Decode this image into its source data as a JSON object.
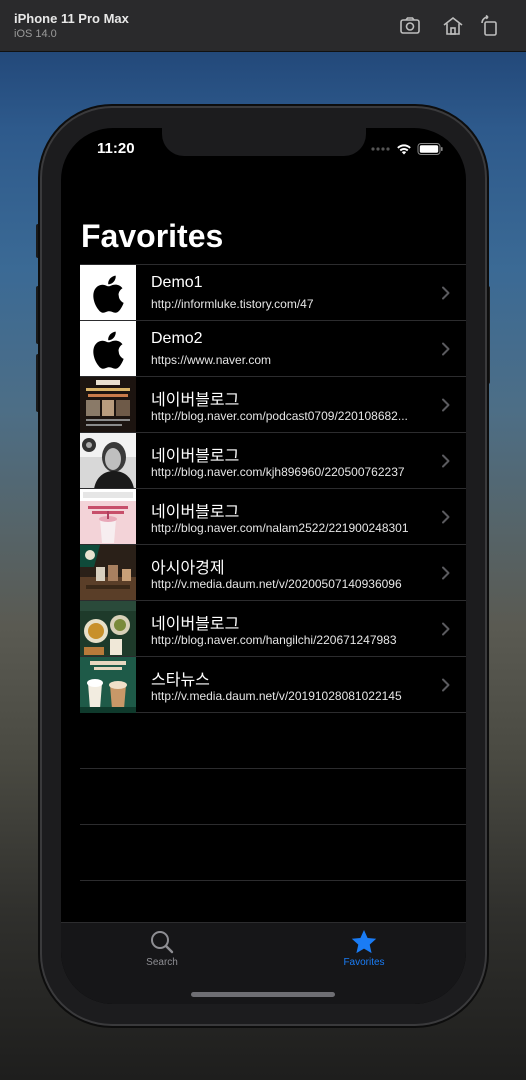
{
  "simulator": {
    "device_name": "iPhone 11 Pro Max",
    "os_version": "iOS 14.0",
    "buttons": [
      {
        "name": "screenshot-icon"
      },
      {
        "name": "home-icon"
      },
      {
        "name": "rotate-icon"
      }
    ]
  },
  "status_bar": {
    "time": "11:20"
  },
  "nav": {
    "title": "Favorites"
  },
  "favorites": [
    {
      "title": "Demo1",
      "url": "http://informluke.tistory.com/47",
      "thumb": "apple-logo"
    },
    {
      "title": "Demo2",
      "url": "https://www.naver.com",
      "thumb": "apple-logo"
    },
    {
      "title": "네이버블로그",
      "url": "http://blog.naver.com/podcast0709/220108682...",
      "thumb": "blog-post"
    },
    {
      "title": "네이버블로그",
      "url": "http://blog.naver.com/kjh896960/220500762237",
      "thumb": "portrait-photo"
    },
    {
      "title": "네이버블로그",
      "url": "http://blog.naver.com/nalam2522/221900248301",
      "thumb": "beautiful-moments-ad"
    },
    {
      "title": "아시아경제",
      "url": "http://v.media.daum.net/v/20200507140936096",
      "thumb": "cafe-photo"
    },
    {
      "title": "네이버블로그",
      "url": "http://blog.naver.com/hangilchi/220671247983",
      "thumb": "food-photo"
    },
    {
      "title": "스타뉴스",
      "url": "http://v.media.daum.net/v/20191028081022145",
      "thumb": "christmas-drinks"
    }
  ],
  "tabbar": {
    "tabs": [
      {
        "label": "Search",
        "icon": "search-icon",
        "selected": false
      },
      {
        "label": "Favorites",
        "icon": "star-icon",
        "selected": true
      }
    ],
    "colors": {
      "selected": "#1a7cf5",
      "unselected": "#8e8e93"
    }
  }
}
